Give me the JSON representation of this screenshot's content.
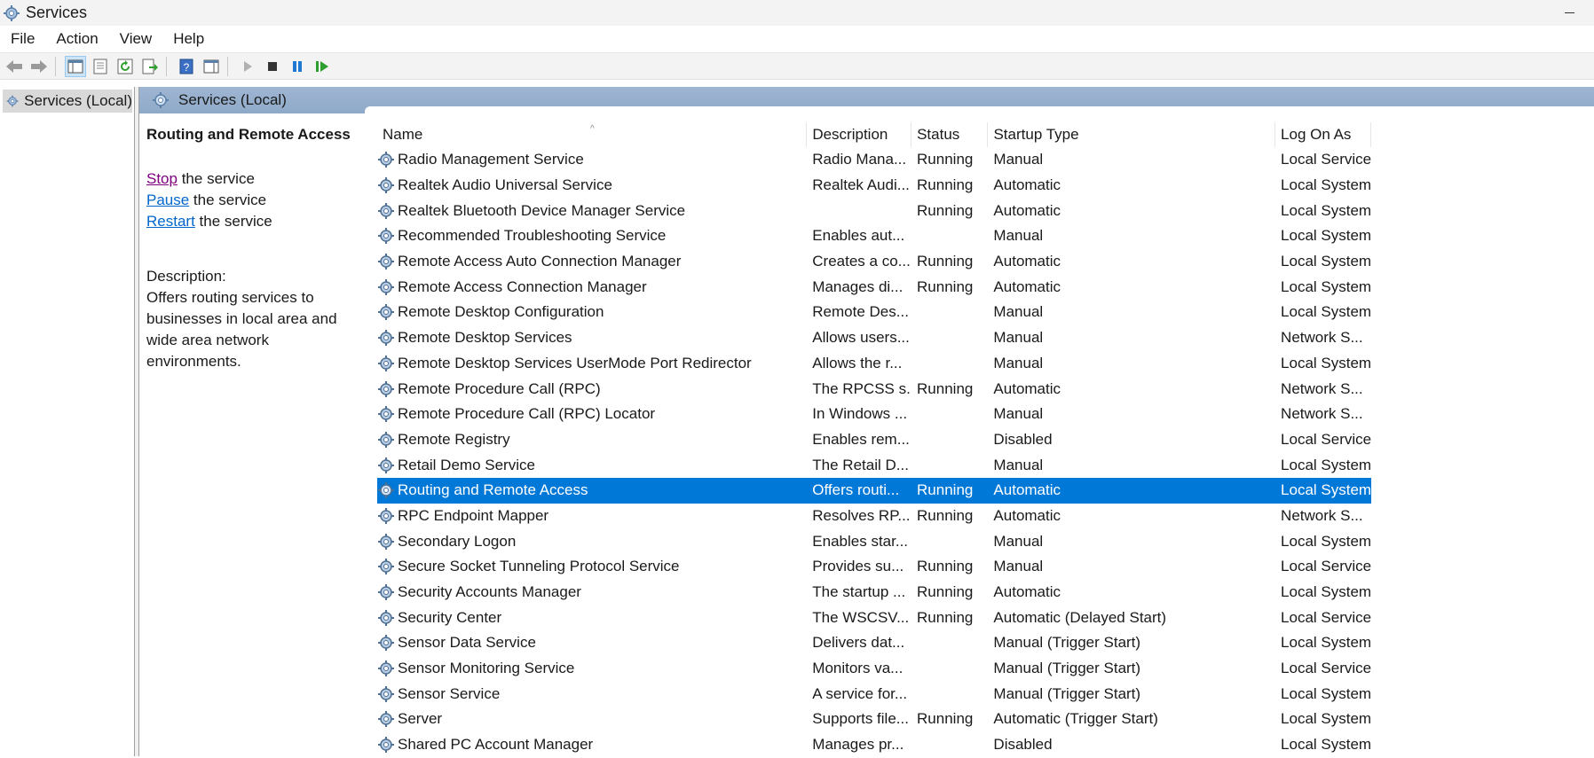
{
  "window": {
    "title": "Services"
  },
  "menu": [
    "File",
    "Action",
    "View",
    "Help"
  ],
  "tree": {
    "root_label": "Services (Local)"
  },
  "content_header": {
    "title": "Services (Local)"
  },
  "extended": {
    "selected_title": "Routing and Remote Access",
    "actions": [
      {
        "link": "Stop",
        "rest": " the service"
      },
      {
        "link": "Pause",
        "rest": " the service"
      },
      {
        "link": "Restart",
        "rest": " the service"
      }
    ],
    "description_label": "Description:",
    "description": "Offers routing services to businesses in local area and wide area network environments."
  },
  "columns": [
    "Name",
    "Description",
    "Status",
    "Startup Type",
    "Log On As"
  ],
  "rows": [
    {
      "name": "Radio Management Service",
      "description": "Radio Mana...",
      "status": "Running",
      "startup": "Manual",
      "logon": "Local Service"
    },
    {
      "name": "Realtek Audio Universal Service",
      "description": "Realtek Audi...",
      "status": "Running",
      "startup": "Automatic",
      "logon": "Local System"
    },
    {
      "name": "Realtek Bluetooth Device Manager Service",
      "description": "",
      "status": "Running",
      "startup": "Automatic",
      "logon": "Local System"
    },
    {
      "name": "Recommended Troubleshooting Service",
      "description": "Enables aut...",
      "status": "",
      "startup": "Manual",
      "logon": "Local System"
    },
    {
      "name": "Remote Access Auto Connection Manager",
      "description": "Creates a co...",
      "status": "Running",
      "startup": "Automatic",
      "logon": "Local System"
    },
    {
      "name": "Remote Access Connection Manager",
      "description": "Manages di...",
      "status": "Running",
      "startup": "Automatic",
      "logon": "Local System"
    },
    {
      "name": "Remote Desktop Configuration",
      "description": "Remote Des...",
      "status": "",
      "startup": "Manual",
      "logon": "Local System"
    },
    {
      "name": "Remote Desktop Services",
      "description": "Allows users...",
      "status": "",
      "startup": "Manual",
      "logon": "Network S..."
    },
    {
      "name": "Remote Desktop Services UserMode Port Redirector",
      "description": "Allows the r...",
      "status": "",
      "startup": "Manual",
      "logon": "Local System"
    },
    {
      "name": "Remote Procedure Call (RPC)",
      "description": "The RPCSS s...",
      "status": "Running",
      "startup": "Automatic",
      "logon": "Network S..."
    },
    {
      "name": "Remote Procedure Call (RPC) Locator",
      "description": "In Windows ...",
      "status": "",
      "startup": "Manual",
      "logon": "Network S..."
    },
    {
      "name": "Remote Registry",
      "description": "Enables rem...",
      "status": "",
      "startup": "Disabled",
      "logon": "Local Service"
    },
    {
      "name": "Retail Demo Service",
      "description": "The Retail D...",
      "status": "",
      "startup": "Manual",
      "logon": "Local System"
    },
    {
      "name": "Routing and Remote Access",
      "description": "Offers routi...",
      "status": "Running",
      "startup": "Automatic",
      "logon": "Local System",
      "selected": true
    },
    {
      "name": "RPC Endpoint Mapper",
      "description": "Resolves RP...",
      "status": "Running",
      "startup": "Automatic",
      "logon": "Network S..."
    },
    {
      "name": "Secondary Logon",
      "description": "Enables star...",
      "status": "",
      "startup": "Manual",
      "logon": "Local System"
    },
    {
      "name": "Secure Socket Tunneling Protocol Service",
      "description": "Provides su...",
      "status": "Running",
      "startup": "Manual",
      "logon": "Local Service"
    },
    {
      "name": "Security Accounts Manager",
      "description": "The startup ...",
      "status": "Running",
      "startup": "Automatic",
      "logon": "Local System"
    },
    {
      "name": "Security Center",
      "description": "The WSCSV...",
      "status": "Running",
      "startup": "Automatic (Delayed Start)",
      "logon": "Local Service"
    },
    {
      "name": "Sensor Data Service",
      "description": "Delivers dat...",
      "status": "",
      "startup": "Manual (Trigger Start)",
      "logon": "Local System"
    },
    {
      "name": "Sensor Monitoring Service",
      "description": "Monitors va...",
      "status": "",
      "startup": "Manual (Trigger Start)",
      "logon": "Local Service"
    },
    {
      "name": "Sensor Service",
      "description": "A service for...",
      "status": "",
      "startup": "Manual (Trigger Start)",
      "logon": "Local System"
    },
    {
      "name": "Server",
      "description": "Supports file...",
      "status": "Running",
      "startup": "Automatic (Trigger Start)",
      "logon": "Local System"
    },
    {
      "name": "Shared PC Account Manager",
      "description": "Manages pr...",
      "status": "",
      "startup": "Disabled",
      "logon": "Local System"
    }
  ],
  "colors": {
    "selection": "#0078d7",
    "header_band": "#9fb6d2",
    "link": "#0066cc",
    "visited_link": "#800080"
  }
}
